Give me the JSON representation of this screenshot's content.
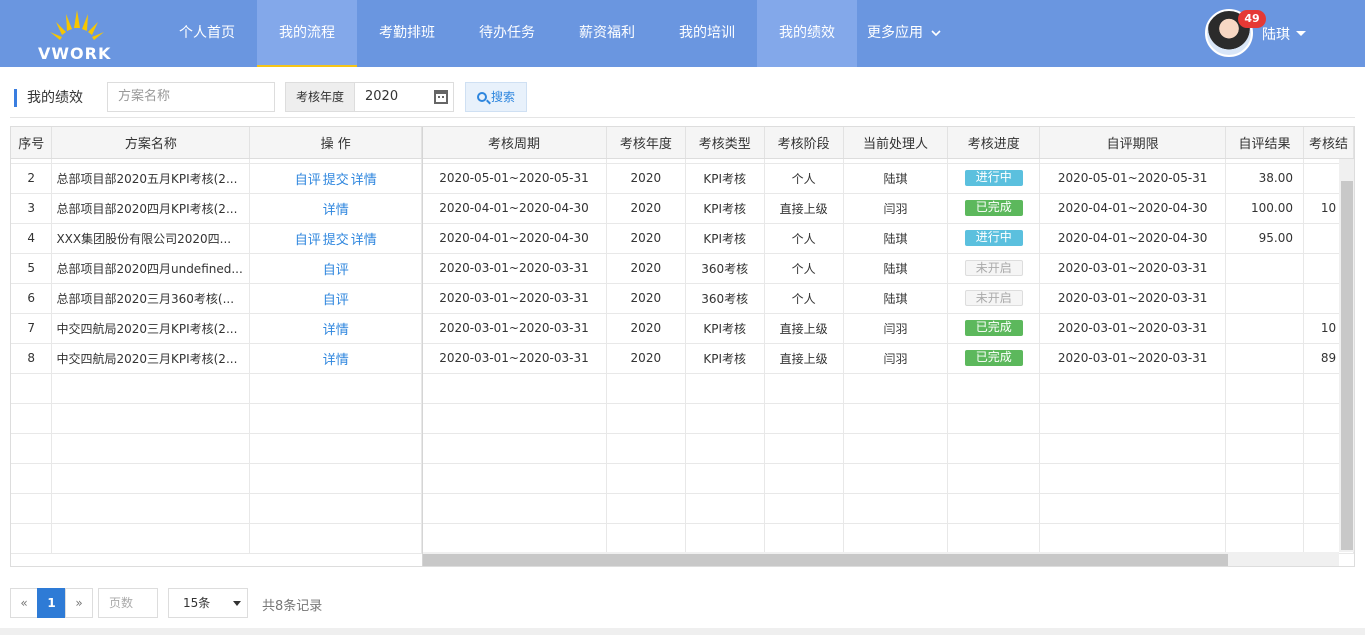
{
  "brand": {
    "logo_text": "VWORK"
  },
  "nav": {
    "items": [
      {
        "label": "个人首页"
      },
      {
        "label": "我的流程"
      },
      {
        "label": "考勤排班"
      },
      {
        "label": "待办任务"
      },
      {
        "label": "薪资福利"
      },
      {
        "label": "我的培训"
      },
      {
        "label": "我的绩效"
      },
      {
        "label": "更多应用"
      }
    ],
    "active_index": 1,
    "highlight_index": 6
  },
  "user": {
    "name": "陆琪",
    "notification_count": "49"
  },
  "toolbar": {
    "title": "我的绩效",
    "name_placeholder": "方案名称",
    "year_label": "考核年度",
    "year_value": "2020",
    "search_label": "搜索"
  },
  "table": {
    "columns": [
      "序号",
      "方案名称",
      "操 作",
      "考核周期",
      "考核年度",
      "考核类型",
      "考核阶段",
      "当前处理人",
      "考核进度",
      "自评期限",
      "自评结果",
      "考核结"
    ],
    "rows": [
      {
        "no": "2",
        "name": "总部项目部2020五月KPI考核(2...",
        "ops": [
          "自评",
          "提交",
          "详情"
        ],
        "period": "2020-05-01~2020-05-31",
        "year": "2020",
        "type": "KPI考核",
        "stage": "个人",
        "handler": "陆琪",
        "progress": "进行中",
        "progress_state": "ongoing",
        "self_period": "2020-05-01~2020-05-31",
        "self_result": "38.00",
        "result": ""
      },
      {
        "no": "3",
        "name": "总部项目部2020四月KPI考核(2...",
        "ops": [
          "详情"
        ],
        "period": "2020-04-01~2020-04-30",
        "year": "2020",
        "type": "KPI考核",
        "stage": "直接上级",
        "handler": "闫羽",
        "progress": "已完成",
        "progress_state": "done",
        "self_period": "2020-04-01~2020-04-30",
        "self_result": "100.00",
        "result": "10"
      },
      {
        "no": "4",
        "name": "XXX集团股份有限公司2020四...",
        "ops": [
          "自评",
          "提交",
          "详情"
        ],
        "period": "2020-04-01~2020-04-30",
        "year": "2020",
        "type": "KPI考核",
        "stage": "个人",
        "handler": "陆琪",
        "progress": "进行中",
        "progress_state": "ongoing",
        "self_period": "2020-04-01~2020-04-30",
        "self_result": "95.00",
        "result": ""
      },
      {
        "no": "5",
        "name": "总部项目部2020四月undefined...",
        "ops": [
          "自评"
        ],
        "period": "2020-03-01~2020-03-31",
        "year": "2020",
        "type": "360考核",
        "stage": "个人",
        "handler": "陆琪",
        "progress": "未开启",
        "progress_state": "pending",
        "self_period": "2020-03-01~2020-03-31",
        "self_result": "",
        "result": ""
      },
      {
        "no": "6",
        "name": "总部项目部2020三月360考核(...",
        "ops": [
          "自评"
        ],
        "period": "2020-03-01~2020-03-31",
        "year": "2020",
        "type": "360考核",
        "stage": "个人",
        "handler": "陆琪",
        "progress": "未开启",
        "progress_state": "pending",
        "self_period": "2020-03-01~2020-03-31",
        "self_result": "",
        "result": ""
      },
      {
        "no": "7",
        "name": "中交四航局2020三月KPI考核(2...",
        "ops": [
          "详情"
        ],
        "period": "2020-03-01~2020-03-31",
        "year": "2020",
        "type": "KPI考核",
        "stage": "直接上级",
        "handler": "闫羽",
        "progress": "已完成",
        "progress_state": "done",
        "self_period": "2020-03-01~2020-03-31",
        "self_result": "",
        "result": "10"
      },
      {
        "no": "8",
        "name": "中交四航局2020三月KPI考核(2...",
        "ops": [
          "详情"
        ],
        "period": "2020-03-01~2020-03-31",
        "year": "2020",
        "type": "KPI考核",
        "stage": "直接上级",
        "handler": "闫羽",
        "progress": "已完成",
        "progress_state": "done",
        "self_period": "2020-03-01~2020-03-31",
        "self_result": "",
        "result": "89"
      }
    ]
  },
  "pager": {
    "prev": "«",
    "current": "1",
    "next": "»",
    "page_placeholder": "页数",
    "page_size": "15条",
    "total_text": "共8条记录"
  },
  "colors": {
    "header_bg": "#6a96e0",
    "accent": "#2e7bd6",
    "ongoing": "#5bc0de",
    "done": "#5cb85c"
  }
}
